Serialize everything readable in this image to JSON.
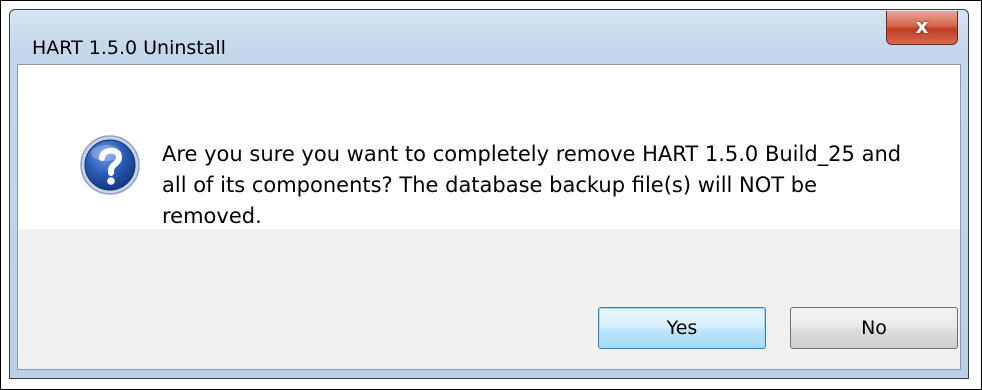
{
  "window": {
    "title": "HART 1.5.0 Uninstall",
    "close_label": "x"
  },
  "dialog": {
    "icon": "question-icon",
    "message": "Are you sure you want to completely remove HART 1.5.0 Build_25 and all of its components? The database backup file(s) will NOT be removed."
  },
  "buttons": {
    "yes_label": "Yes",
    "no_label": "No"
  },
  "colors": {
    "titlebar": "#c4d6ea",
    "close_button": "#c03b23",
    "icon_blue": "#1f4fa6",
    "footer": "#f0f0f0",
    "default_button_border": "#3c7fb1"
  }
}
